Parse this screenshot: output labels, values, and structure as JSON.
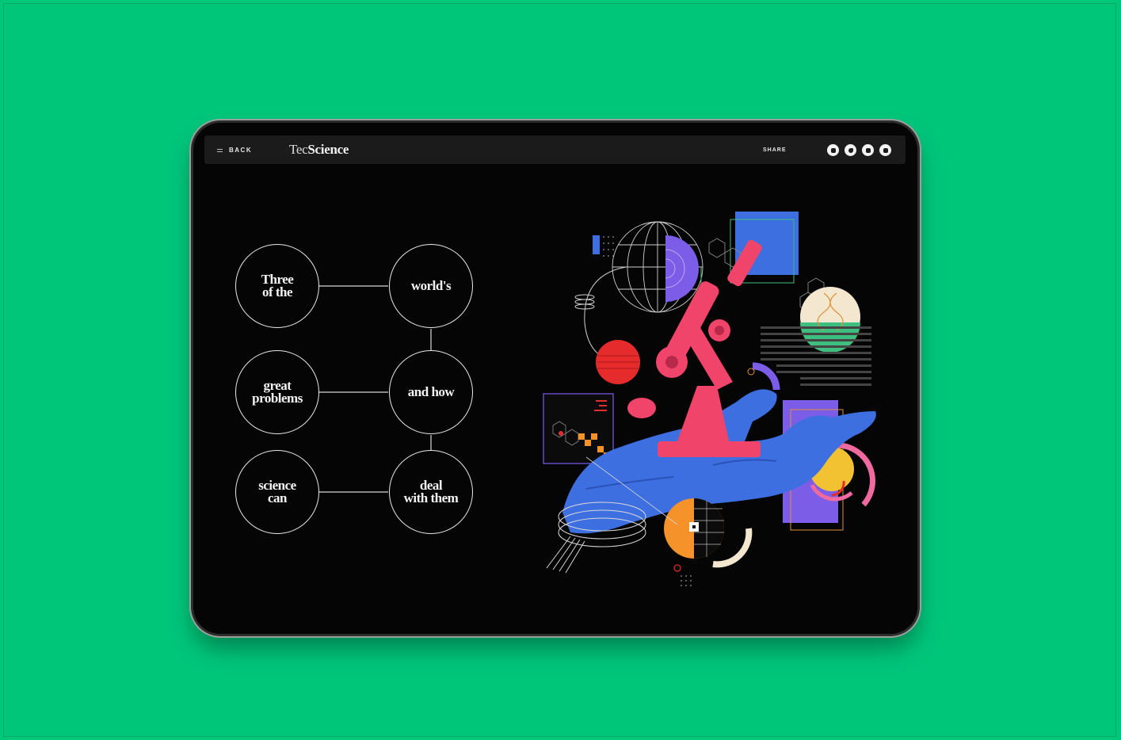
{
  "header": {
    "back_label": "BACK",
    "logo_light": "Tec",
    "logo_bold": "Science",
    "share_label": "SHARE",
    "social_icons": [
      "facebook-icon",
      "twitter-icon",
      "linkedin-icon",
      "email-icon"
    ]
  },
  "diagram": {
    "nodes": [
      "Three\nof the",
      "world's",
      "great\nproblems",
      "and how",
      "science\ncan",
      "deal\nwith them"
    ]
  },
  "colors": {
    "background": "#00c67a",
    "screen": "#050505",
    "topbar": "#1b1b1b",
    "pink": "#f0446a",
    "blue": "#3d6fe0",
    "orange": "#f5922a",
    "purple": "#7b5de8",
    "red": "#e52b2b"
  }
}
